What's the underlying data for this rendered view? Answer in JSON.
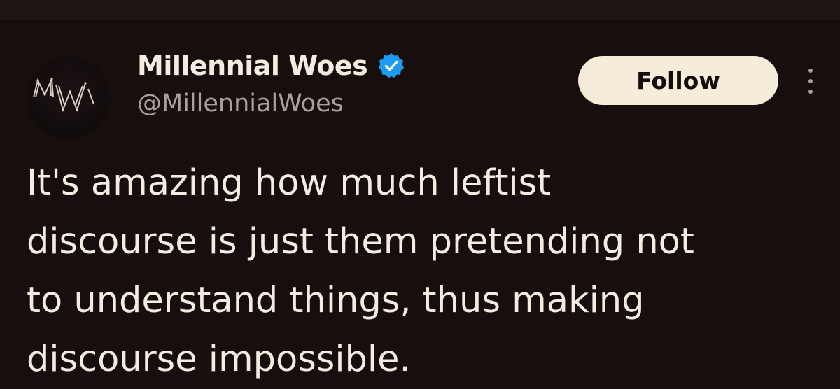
{
  "tweet": {
    "author": {
      "display_name": "Millennial Woes",
      "handle": "@MillennialWoes",
      "verified": true,
      "avatar_icon": "mw-monogram-avatar",
      "verified_color": "#1d9bf0"
    },
    "follow_label": "Follow",
    "more_icon": "more-vertical-icon",
    "text_lines": [
      "It's amazing how much leftist",
      "discourse is just them pretending not",
      "to understand things, thus making",
      "discourse impossible."
    ]
  }
}
